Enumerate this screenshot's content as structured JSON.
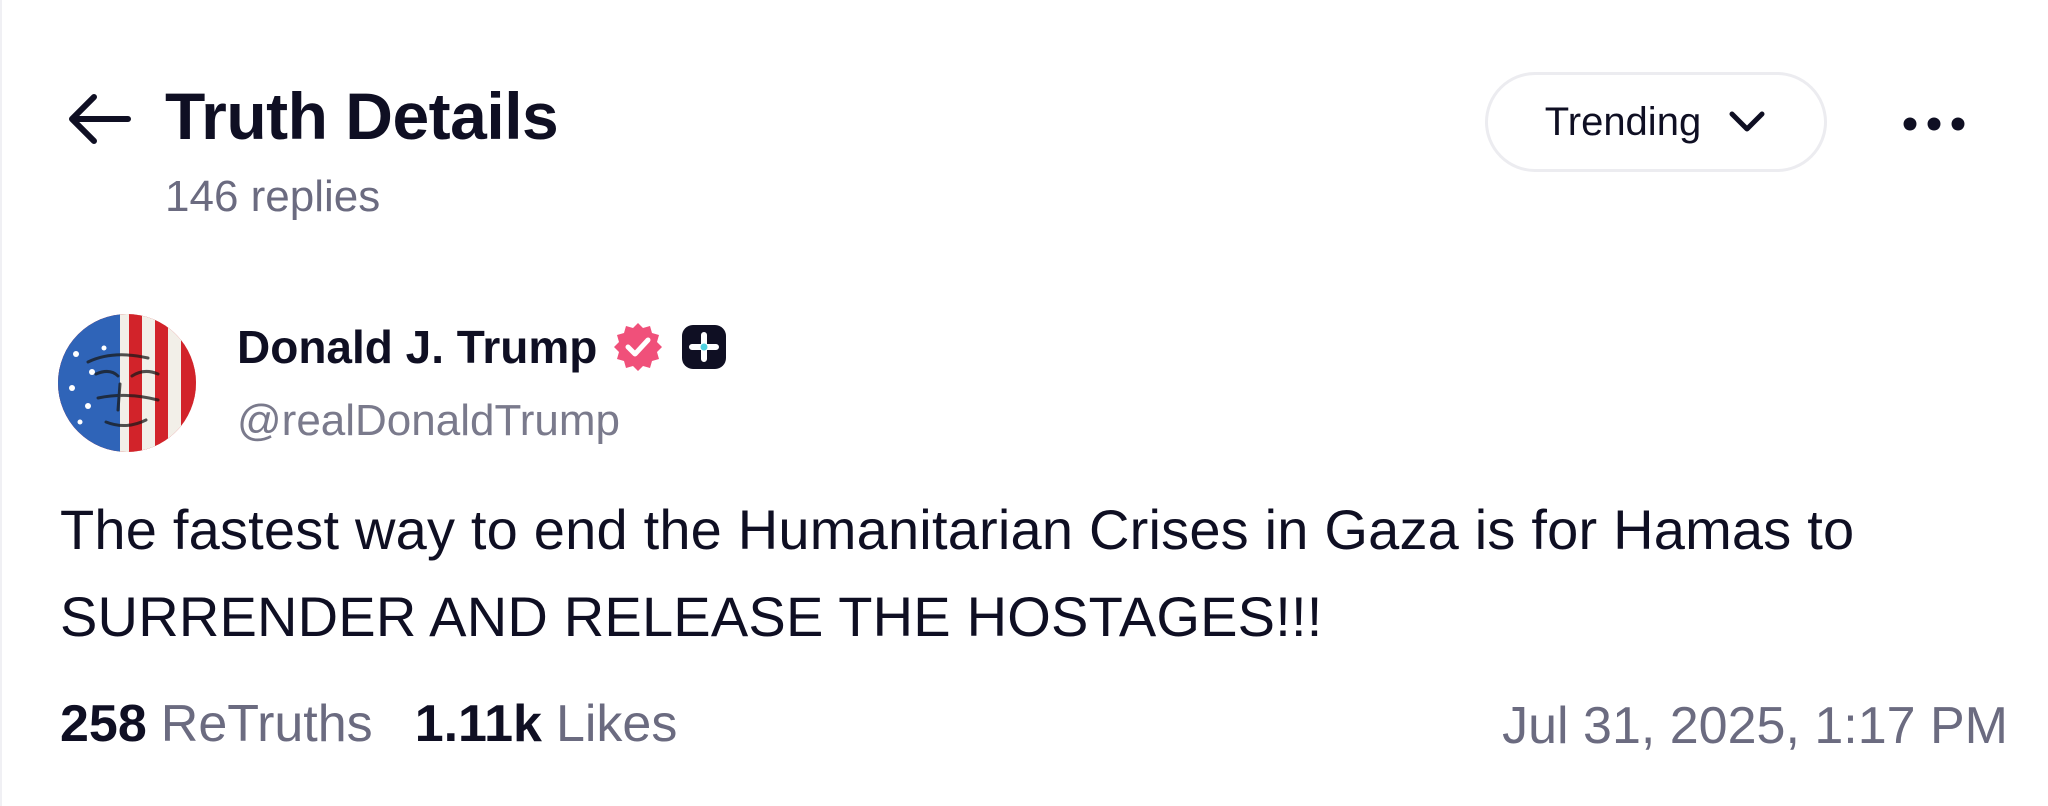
{
  "header": {
    "title": "Truth Details",
    "replies": "146 replies",
    "sort_label": "Trending"
  },
  "post": {
    "display_name": "Donald J. Trump",
    "handle": "@realDonaldTrump",
    "text": "The fastest way to end the Humanitarian Crises in Gaza is for Hamas to SURRENDER AND RELEASE THE HOSTAGES!!!",
    "retruths_count": "258",
    "retruths_label": "ReTruths",
    "likes_count": "1.11k",
    "likes_label": "Likes",
    "timestamp": "Jul 31, 2025, 1:17 PM"
  },
  "icons": {
    "back": "arrow-left-icon",
    "sort": "chevron-down-icon",
    "more": "more-horizontal-icon",
    "verified": "verified-badge-icon",
    "plus": "plus-badge-icon"
  },
  "colors": {
    "verified": "#f0507a",
    "plus_badge": "#0f0f23",
    "text_primary": "#0f0f23",
    "text_secondary": "#6b6b80"
  }
}
